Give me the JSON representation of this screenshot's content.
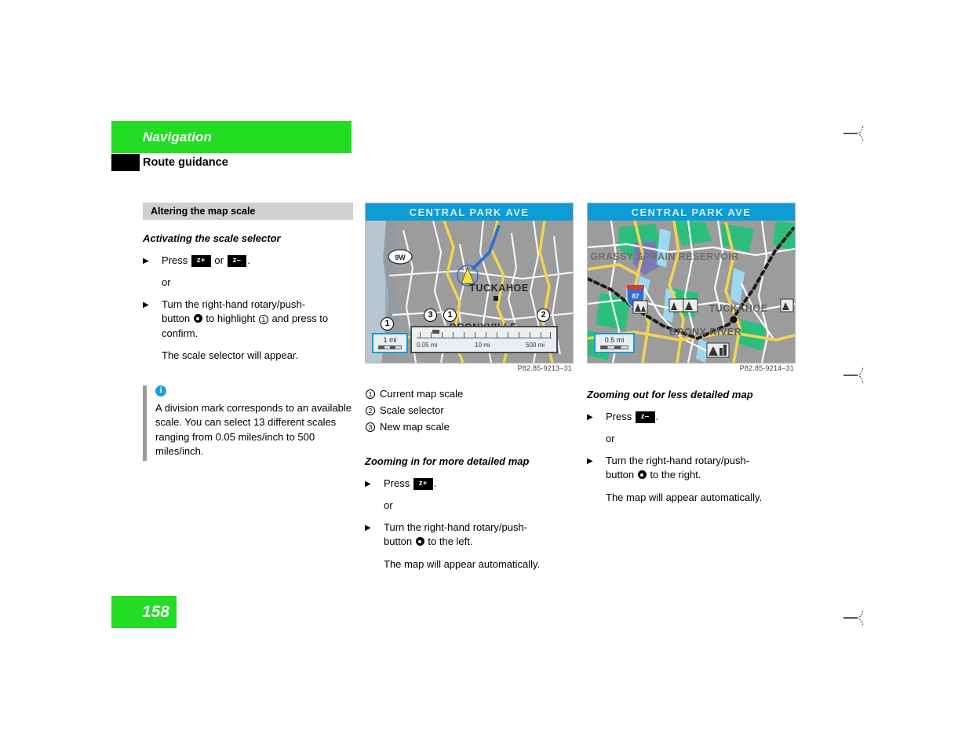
{
  "colors": {
    "brand_green": "#22dd22",
    "map_banner_blue": "#0d9dd4",
    "info_icon_blue": "#1a9fd9",
    "grey_bar": "#d0d0d0",
    "note_rule_grey": "#9a9a9a"
  },
  "header": {
    "chapter": "Navigation",
    "section": "Route guidance"
  },
  "left_column": {
    "grey_heading": "Altering the map scale",
    "subhead": "Activating the scale selector",
    "step1": {
      "pre": "Press",
      "key_a": "z+",
      "mid": "or",
      "key_b": "z–",
      "post": "."
    },
    "or_label": "or",
    "step2": {
      "line1": "Turn the right-hand rotary/push-",
      "line2_a": "button",
      "line2_b": "to highlight",
      "line2_c": "and press to",
      "line3": "confirm.",
      "circled": "1"
    },
    "result": "The scale selector will appear.",
    "note": {
      "icon": "info-icon",
      "icon_glyph": "i",
      "text": "A division mark corresponds to an available scale. You can select 13 different scales ranging from 0.05 miles/inch to 500 miles/inch."
    }
  },
  "figure_left": {
    "banner": "CENTRAL PARK AVE",
    "code": "P82.85-9213–31",
    "current_scale": "1 mi",
    "ruler_labels": [
      "0.05 mi",
      "10 mi",
      "500 mi"
    ],
    "place_labels": [
      "TUCKAHOE",
      "BRONXVILLE"
    ],
    "route_shield": "9W",
    "callouts": [
      {
        "id": "1",
        "label": "1"
      },
      {
        "id": "3",
        "label": "3"
      },
      {
        "id": "1b",
        "label": "1"
      },
      {
        "id": "2",
        "label": "2"
      }
    ]
  },
  "figure_right": {
    "banner": "CENTRAL PARK AVE",
    "code": "P82.85-9214–31",
    "current_scale": "0.5 mi",
    "place_labels": [
      "GRASSY SPRAIN RESERVOIR",
      "TUCKAHOE",
      "BRONX RIVER"
    ],
    "route_shield": "87"
  },
  "mid_column": {
    "legend": [
      {
        "num": "1",
        "text": "Current map scale"
      },
      {
        "num": "2",
        "text": "Scale selector"
      },
      {
        "num": "3",
        "text": "New map scale"
      }
    ],
    "subhead": "Zooming in for more detailed map",
    "step1": {
      "pre": "Press",
      "key": "z+",
      "post": "."
    },
    "or_label": "or",
    "step2": {
      "line1": "Turn the right-hand rotary/push-",
      "line2_a": "button",
      "line2_b": "to the left."
    },
    "result": "The map will appear automatically."
  },
  "right_column": {
    "subhead": "Zooming out for less detailed map",
    "step1": {
      "pre": "Press",
      "key": "z–",
      "post": "."
    },
    "or_label": "or",
    "step2": {
      "line1": "Turn the right-hand rotary/push-",
      "line2_a": "button",
      "line2_b": "to the right."
    },
    "result": "The map will appear automatically."
  },
  "footer": {
    "page_number": "158"
  }
}
